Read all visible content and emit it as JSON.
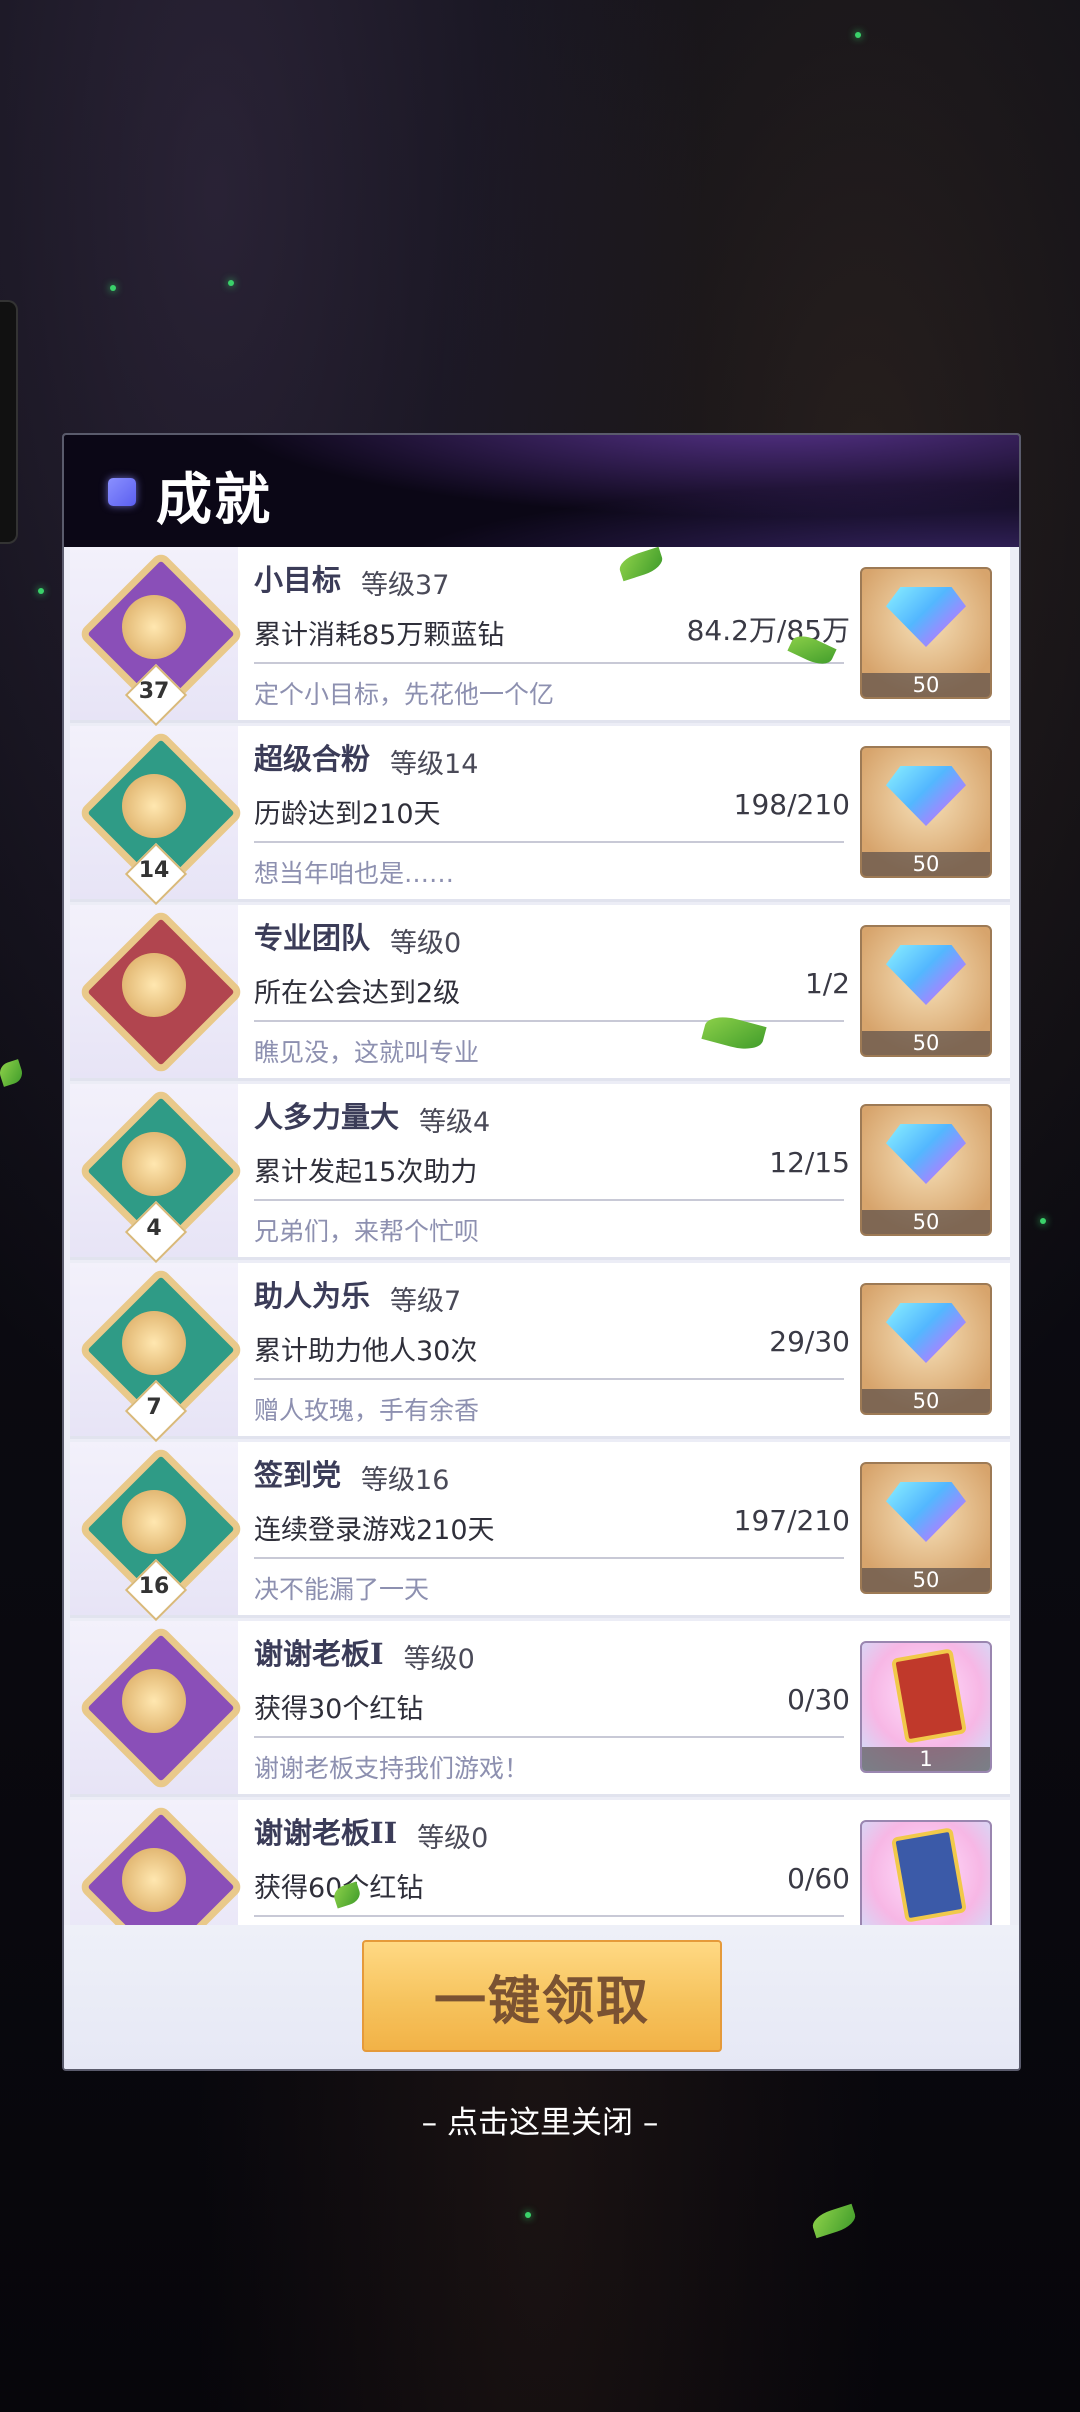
{
  "panel": {
    "title": "成就",
    "claim_all": "一键领取",
    "close_hint": "– 点击这里关闭 –"
  },
  "achievements": [
    {
      "name": "小目标",
      "level": "等级37",
      "badge_level": "37",
      "task": "累计消耗85万颗蓝钻",
      "progress": "84.2万/85万",
      "desc": "定个小目标，先花他一个亿",
      "reward_type": "diamond",
      "reward_count": "50",
      "badge_color": "#8a4fb8"
    },
    {
      "name": "超级合粉",
      "level": "等级14",
      "badge_level": "14",
      "task": "历龄达到210天",
      "progress": "198/210",
      "desc": "想当年咱也是……",
      "reward_type": "diamond",
      "reward_count": "50",
      "badge_color": "#2f9b86"
    },
    {
      "name": "专业团队",
      "level": "等级0",
      "badge_level": "",
      "task": "所在公会达到2级",
      "progress": "1/2",
      "desc": "瞧见没，这就叫专业",
      "reward_type": "diamond",
      "reward_count": "50",
      "badge_color": "#b1454f"
    },
    {
      "name": "人多力量大",
      "level": "等级4",
      "badge_level": "4",
      "task": "累计发起15次助力",
      "progress": "12/15",
      "desc": "兄弟们，来帮个忙呗",
      "reward_type": "diamond",
      "reward_count": "50",
      "badge_color": "#2f9b86"
    },
    {
      "name": "助人为乐",
      "level": "等级7",
      "badge_level": "7",
      "task": "累计助力他人30次",
      "progress": "29/30",
      "desc": "赠人玫瑰，手有余香",
      "reward_type": "diamond",
      "reward_count": "50",
      "badge_color": "#2f9b86"
    },
    {
      "name": "签到党",
      "level": "等级16",
      "badge_level": "16",
      "task": "连续登录游戏210天",
      "progress": "197/210",
      "desc": "决不能漏了一天",
      "reward_type": "diamond",
      "reward_count": "50",
      "badge_color": "#2f9b86"
    },
    {
      "name": "谢谢老板I",
      "level": "等级0",
      "badge_level": "",
      "task": "获得30个红钻",
      "progress": "0/30",
      "desc": "谢谢老板支持我们游戏！",
      "reward_type": "card-red",
      "reward_count": "1",
      "badge_color": "#8a4fb8"
    },
    {
      "name": "谢谢老板II",
      "level": "等级0",
      "badge_level": "",
      "task": "获得60个红钻",
      "progress": "0/60",
      "desc": "",
      "reward_type": "card-blue",
      "reward_count": "",
      "badge_color": "#8a4fb8"
    }
  ]
}
